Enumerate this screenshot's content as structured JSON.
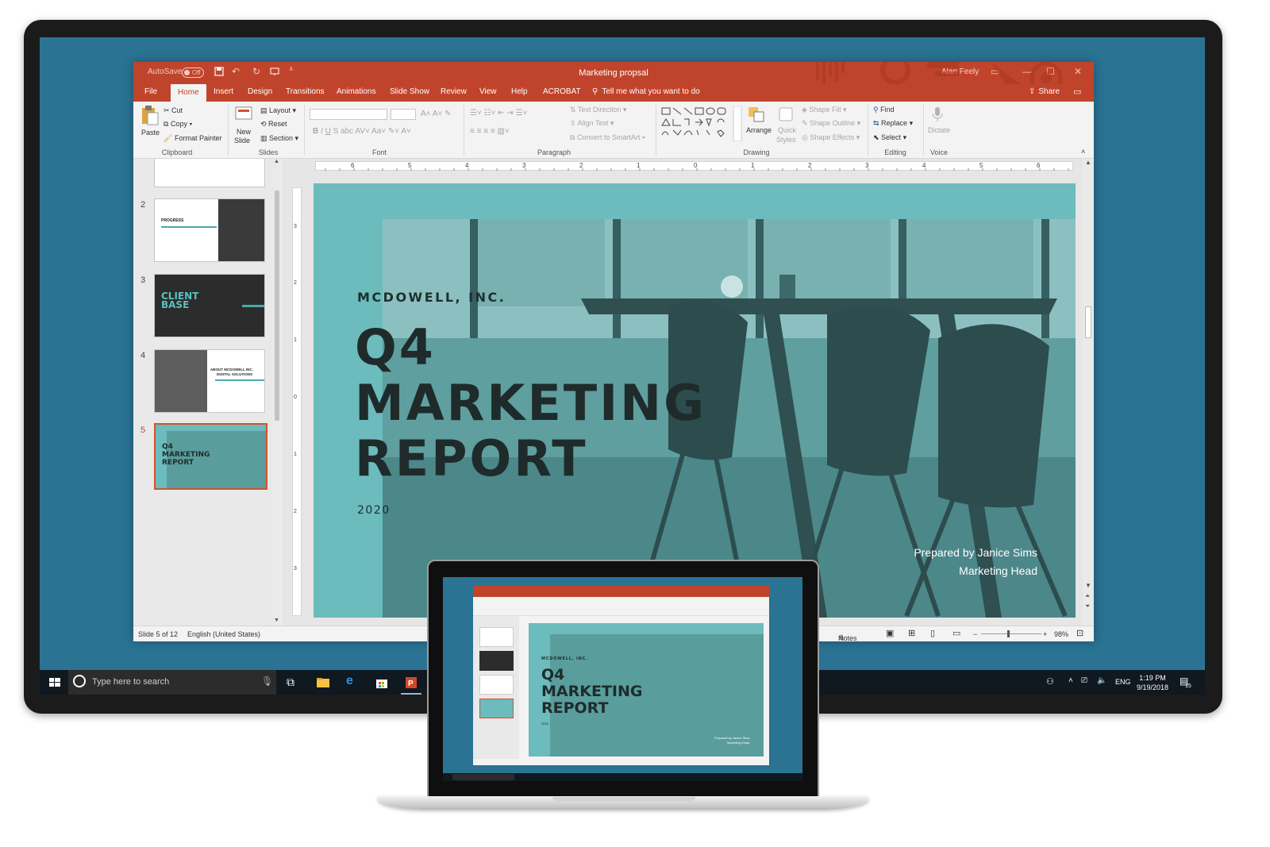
{
  "window": {
    "autosave_label": "AutoSave",
    "autosave_state": "Off",
    "doc_title": "Marketing propsal",
    "user": "Alan Feely"
  },
  "tabs": [
    "File",
    "Home",
    "Insert",
    "Design",
    "Transitions",
    "Animations",
    "Slide Show",
    "Review",
    "View",
    "Help",
    "ACROBAT"
  ],
  "active_tab": "Home",
  "tell_me": "Tell me what you want to do",
  "share": "Share",
  "ribbon": {
    "clipboard": {
      "paste": "Paste",
      "cut": "Cut",
      "copy": "Copy",
      "format_painter": "Format Painter",
      "label": "Clipboard"
    },
    "slides": {
      "new_slide_1": "New",
      "new_slide_2": "Slide",
      "layout": "Layout",
      "reset": "Reset",
      "section": "Section",
      "label": "Slides"
    },
    "font": {
      "label": "Font"
    },
    "paragraph": {
      "text_direction": "Text Direction",
      "align_text": "Align Text",
      "convert": "Convert to SmartArt",
      "label": "Paragraph"
    },
    "drawing": {
      "arrange": "Arrange",
      "quick_styles_1": "Quick",
      "quick_styles_2": "Styles",
      "shape_fill": "Shape Fill",
      "shape_outline": "Shape Outline",
      "shape_effects": "Shape Effects",
      "label": "Drawing"
    },
    "editing": {
      "find": "Find",
      "replace": "Replace",
      "select": "Select",
      "label": "Editing"
    },
    "voice": {
      "dictate": "Dictate",
      "label": "Voice"
    }
  },
  "thumbnails": [
    {
      "num": "2",
      "title": "PROGRESS"
    },
    {
      "num": "3",
      "title_1": "CLIENT",
      "title_2": "BASE"
    },
    {
      "num": "4",
      "title_1": "ABOUT MCDOWELL INC.",
      "title_2": "DIGITAL SOLUTIONS"
    },
    {
      "num": "5",
      "title_1": "Q4",
      "title_2": "MARKETING",
      "title_3": "REPORT"
    }
  ],
  "selected_slide": 5,
  "slide": {
    "company": "MCDOWELL, INC.",
    "title_1": "Q4",
    "title_2": "MARKETING",
    "title_3": "REPORT",
    "year": "2020",
    "prepared_by": "Prepared by Janice Sims",
    "role": "Marketing Head"
  },
  "ruler_labels": [
    "6",
    "5",
    "4",
    "3",
    "2",
    "1",
    "0",
    "1",
    "2",
    "3",
    "4",
    "5",
    "6"
  ],
  "vruler_labels": [
    "3",
    "2",
    "1",
    "0",
    "1",
    "2",
    "3"
  ],
  "status": {
    "slide_count": "Slide 5 of 12",
    "language": "English (United States)",
    "notes": "Notes",
    "zoom": "98%"
  },
  "taskbar": {
    "search_placeholder": "Type here to search",
    "language": "ENG",
    "time": "1:19 PM",
    "date": "9/19/2018",
    "notif_count": "15"
  },
  "colors": {
    "accent": "#c0442b",
    "desktop": "#2a7393",
    "slide_bg": "#6cbbbd"
  }
}
